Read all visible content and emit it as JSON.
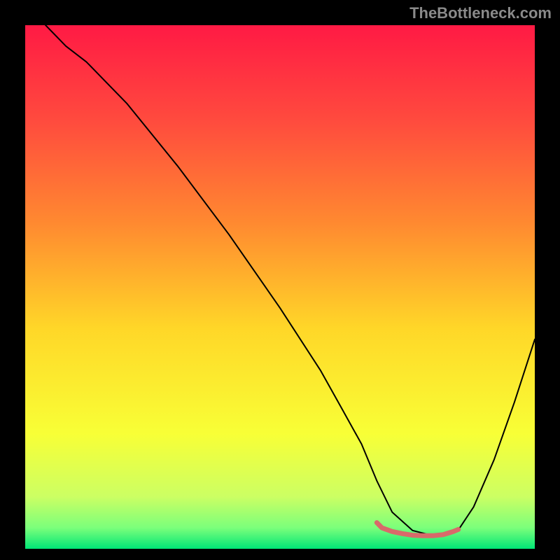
{
  "watermark": "TheBottleneck.com",
  "chart_data": {
    "type": "line",
    "title": "",
    "xlabel": "",
    "ylabel": "",
    "xlim": [
      0,
      100
    ],
    "ylim": [
      0,
      100
    ],
    "grid": false,
    "legend": false,
    "annotations": [],
    "background_gradient_stops": [
      {
        "offset": 0.0,
        "color": "#ff1a44"
      },
      {
        "offset": 0.18,
        "color": "#ff4a3e"
      },
      {
        "offset": 0.38,
        "color": "#ff8a30"
      },
      {
        "offset": 0.58,
        "color": "#ffd728"
      },
      {
        "offset": 0.78,
        "color": "#f8ff36"
      },
      {
        "offset": 0.9,
        "color": "#ccff63"
      },
      {
        "offset": 0.96,
        "color": "#7bff7b"
      },
      {
        "offset": 1.0,
        "color": "#00e676"
      }
    ],
    "series": [
      {
        "name": "bottleneck-curve",
        "stroke": "#000000",
        "stroke_width": 2,
        "x": [
          4,
          8,
          12,
          20,
          30,
          40,
          50,
          58,
          62,
          66,
          69,
          72,
          76,
          80,
          82,
          85,
          88,
          92,
          96,
          100
        ],
        "values": [
          100,
          96,
          93,
          85,
          73,
          60,
          46,
          34,
          27,
          20,
          13,
          7,
          3.5,
          2.5,
          2.7,
          3.6,
          8,
          17,
          28,
          40
        ]
      },
      {
        "name": "ideal-range",
        "stroke": "#d86a6a",
        "stroke_width": 7,
        "x": [
          69,
          70,
          72,
          74,
          76,
          78,
          80,
          82,
          83,
          84,
          85
        ],
        "values": [
          5.0,
          4.0,
          3.3,
          2.9,
          2.6,
          2.5,
          2.5,
          2.7,
          3.0,
          3.3,
          3.7
        ]
      }
    ]
  }
}
